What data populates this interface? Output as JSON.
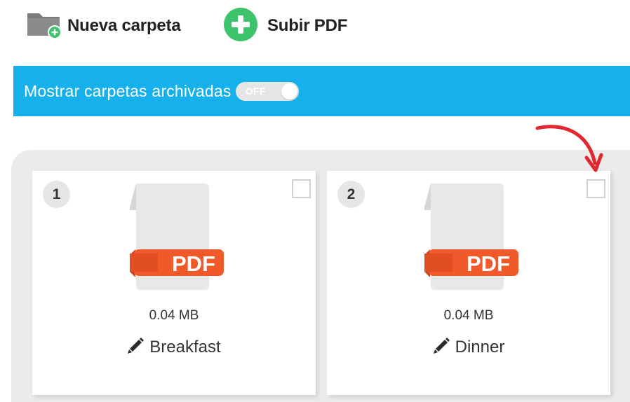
{
  "toolbar": {
    "new_folder_label": "Nueva carpeta",
    "upload_label": "Subir PDF"
  },
  "archive_bar": {
    "label": "Mostrar carpetas archivadas",
    "toggle_text": "OFF",
    "toggle_state": "off"
  },
  "files": [
    {
      "number": "1",
      "icon_text": "PDF",
      "size": "0.04 MB",
      "name": "Breakfast",
      "checked": false
    },
    {
      "number": "2",
      "icon_text": "PDF",
      "size": "0.04 MB",
      "name": "Dinner",
      "checked": false
    }
  ],
  "colors": {
    "accent_blue": "#16b0ea",
    "plus_green": "#3cc36b",
    "pdf_orange": "#f05a2a",
    "annotation_red": "#e0282e"
  },
  "icons": [
    "folder-add-icon",
    "plus-circle-icon",
    "pdf-file-icon",
    "pencil-icon",
    "annotation-arrow-icon"
  ]
}
